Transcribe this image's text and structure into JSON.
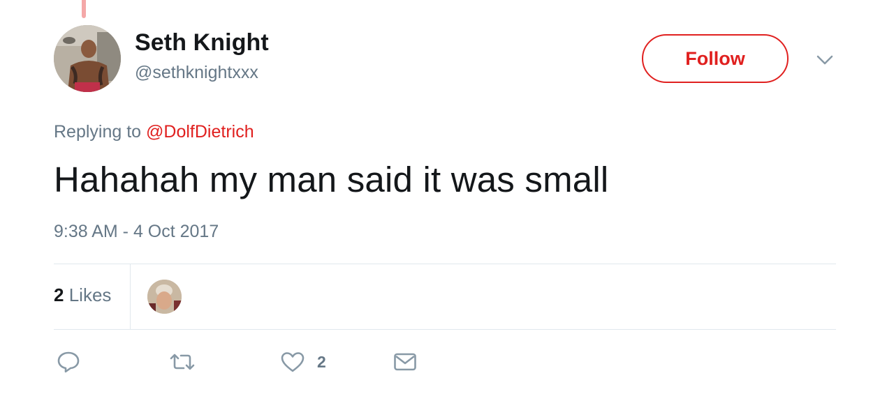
{
  "tweet": {
    "author": {
      "display_name": "Seth Knight",
      "handle": "@sethknightxxx"
    },
    "follow_label": "Follow",
    "reply_context": {
      "prefix": "Replying to",
      "mention": "@DolfDietrich"
    },
    "text": "Hahahah my man said it was small",
    "timestamp": "9:38 AM - 4 Oct 2017",
    "stats": {
      "likes_count": "2",
      "likes_label": "Likes"
    },
    "actions": {
      "like_count": "2"
    }
  },
  "colors": {
    "accent": "#e0201f",
    "secondary_text": "#657786",
    "primary_text": "#14171a",
    "divider": "#e1e8ed",
    "thread_line": "#f4a8a8"
  },
  "icons": [
    "reply-icon",
    "retweet-icon",
    "heart-icon",
    "envelope-icon",
    "chevron-down-icon"
  ]
}
